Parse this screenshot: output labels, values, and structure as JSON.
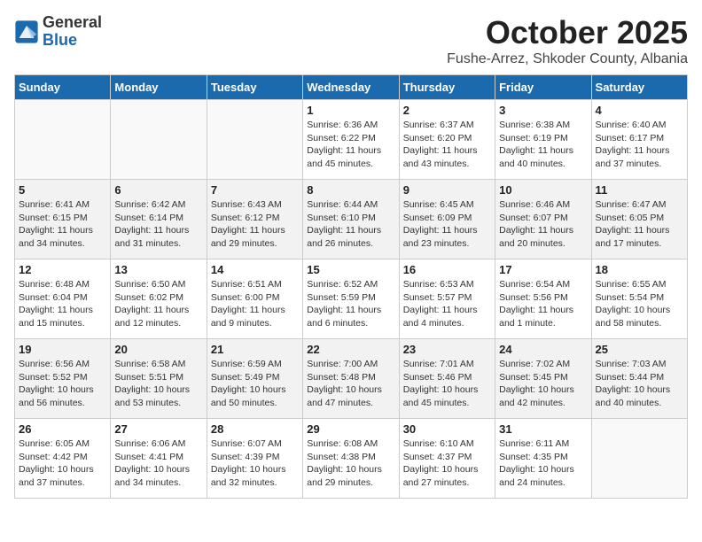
{
  "header": {
    "logo_general": "General",
    "logo_blue": "Blue",
    "month_title": "October 2025",
    "subtitle": "Fushe-Arrez, Shkoder County, Albania"
  },
  "weekdays": [
    "Sunday",
    "Monday",
    "Tuesday",
    "Wednesday",
    "Thursday",
    "Friday",
    "Saturday"
  ],
  "weeks": [
    [
      {
        "day": "",
        "info": ""
      },
      {
        "day": "",
        "info": ""
      },
      {
        "day": "",
        "info": ""
      },
      {
        "day": "1",
        "info": "Sunrise: 6:36 AM\nSunset: 6:22 PM\nDaylight: 11 hours\nand 45 minutes."
      },
      {
        "day": "2",
        "info": "Sunrise: 6:37 AM\nSunset: 6:20 PM\nDaylight: 11 hours\nand 43 minutes."
      },
      {
        "day": "3",
        "info": "Sunrise: 6:38 AM\nSunset: 6:19 PM\nDaylight: 11 hours\nand 40 minutes."
      },
      {
        "day": "4",
        "info": "Sunrise: 6:40 AM\nSunset: 6:17 PM\nDaylight: 11 hours\nand 37 minutes."
      }
    ],
    [
      {
        "day": "5",
        "info": "Sunrise: 6:41 AM\nSunset: 6:15 PM\nDaylight: 11 hours\nand 34 minutes."
      },
      {
        "day": "6",
        "info": "Sunrise: 6:42 AM\nSunset: 6:14 PM\nDaylight: 11 hours\nand 31 minutes."
      },
      {
        "day": "7",
        "info": "Sunrise: 6:43 AM\nSunset: 6:12 PM\nDaylight: 11 hours\nand 29 minutes."
      },
      {
        "day": "8",
        "info": "Sunrise: 6:44 AM\nSunset: 6:10 PM\nDaylight: 11 hours\nand 26 minutes."
      },
      {
        "day": "9",
        "info": "Sunrise: 6:45 AM\nSunset: 6:09 PM\nDaylight: 11 hours\nand 23 minutes."
      },
      {
        "day": "10",
        "info": "Sunrise: 6:46 AM\nSunset: 6:07 PM\nDaylight: 11 hours\nand 20 minutes."
      },
      {
        "day": "11",
        "info": "Sunrise: 6:47 AM\nSunset: 6:05 PM\nDaylight: 11 hours\nand 17 minutes."
      }
    ],
    [
      {
        "day": "12",
        "info": "Sunrise: 6:48 AM\nSunset: 6:04 PM\nDaylight: 11 hours\nand 15 minutes."
      },
      {
        "day": "13",
        "info": "Sunrise: 6:50 AM\nSunset: 6:02 PM\nDaylight: 11 hours\nand 12 minutes."
      },
      {
        "day": "14",
        "info": "Sunrise: 6:51 AM\nSunset: 6:00 PM\nDaylight: 11 hours\nand 9 minutes."
      },
      {
        "day": "15",
        "info": "Sunrise: 6:52 AM\nSunset: 5:59 PM\nDaylight: 11 hours\nand 6 minutes."
      },
      {
        "day": "16",
        "info": "Sunrise: 6:53 AM\nSunset: 5:57 PM\nDaylight: 11 hours\nand 4 minutes."
      },
      {
        "day": "17",
        "info": "Sunrise: 6:54 AM\nSunset: 5:56 PM\nDaylight: 11 hours\nand 1 minute."
      },
      {
        "day": "18",
        "info": "Sunrise: 6:55 AM\nSunset: 5:54 PM\nDaylight: 10 hours\nand 58 minutes."
      }
    ],
    [
      {
        "day": "19",
        "info": "Sunrise: 6:56 AM\nSunset: 5:52 PM\nDaylight: 10 hours\nand 56 minutes."
      },
      {
        "day": "20",
        "info": "Sunrise: 6:58 AM\nSunset: 5:51 PM\nDaylight: 10 hours\nand 53 minutes."
      },
      {
        "day": "21",
        "info": "Sunrise: 6:59 AM\nSunset: 5:49 PM\nDaylight: 10 hours\nand 50 minutes."
      },
      {
        "day": "22",
        "info": "Sunrise: 7:00 AM\nSunset: 5:48 PM\nDaylight: 10 hours\nand 47 minutes."
      },
      {
        "day": "23",
        "info": "Sunrise: 7:01 AM\nSunset: 5:46 PM\nDaylight: 10 hours\nand 45 minutes."
      },
      {
        "day": "24",
        "info": "Sunrise: 7:02 AM\nSunset: 5:45 PM\nDaylight: 10 hours\nand 42 minutes."
      },
      {
        "day": "25",
        "info": "Sunrise: 7:03 AM\nSunset: 5:44 PM\nDaylight: 10 hours\nand 40 minutes."
      }
    ],
    [
      {
        "day": "26",
        "info": "Sunrise: 6:05 AM\nSunset: 4:42 PM\nDaylight: 10 hours\nand 37 minutes."
      },
      {
        "day": "27",
        "info": "Sunrise: 6:06 AM\nSunset: 4:41 PM\nDaylight: 10 hours\nand 34 minutes."
      },
      {
        "day": "28",
        "info": "Sunrise: 6:07 AM\nSunset: 4:39 PM\nDaylight: 10 hours\nand 32 minutes."
      },
      {
        "day": "29",
        "info": "Sunrise: 6:08 AM\nSunset: 4:38 PM\nDaylight: 10 hours\nand 29 minutes."
      },
      {
        "day": "30",
        "info": "Sunrise: 6:10 AM\nSunset: 4:37 PM\nDaylight: 10 hours\nand 27 minutes."
      },
      {
        "day": "31",
        "info": "Sunrise: 6:11 AM\nSunset: 4:35 PM\nDaylight: 10 hours\nand 24 minutes."
      },
      {
        "day": "",
        "info": ""
      }
    ]
  ]
}
